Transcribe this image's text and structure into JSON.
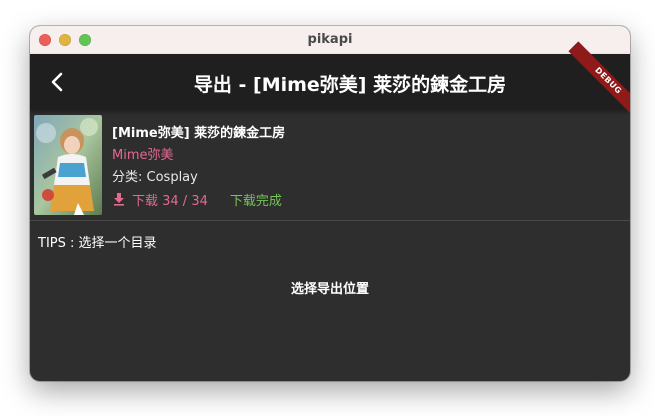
{
  "window": {
    "title": "pikapi"
  },
  "appbar": {
    "title": "导出 - [Mime弥美] 莱莎的鍊金工房",
    "debug_banner": "DEBUG"
  },
  "comic": {
    "title": "[Mime弥美] 莱莎的鍊金工房",
    "author": "Mime弥美",
    "category": "分类: Cosplay",
    "download_progress": "下载 34 / 34",
    "download_status": "下载完成"
  },
  "tips": "TIPS : 选择一个目录",
  "export_button": "选择导出位置",
  "colors": {
    "author_pink": "#e5698f",
    "status_green": "#76c45a",
    "appbar_bg": "#1f1f1f",
    "body_bg": "#2e2e2e",
    "debug_red": "#8e1a1a"
  },
  "icons": [
    "back-arrow-icon",
    "download-icon",
    "cover-image"
  ]
}
